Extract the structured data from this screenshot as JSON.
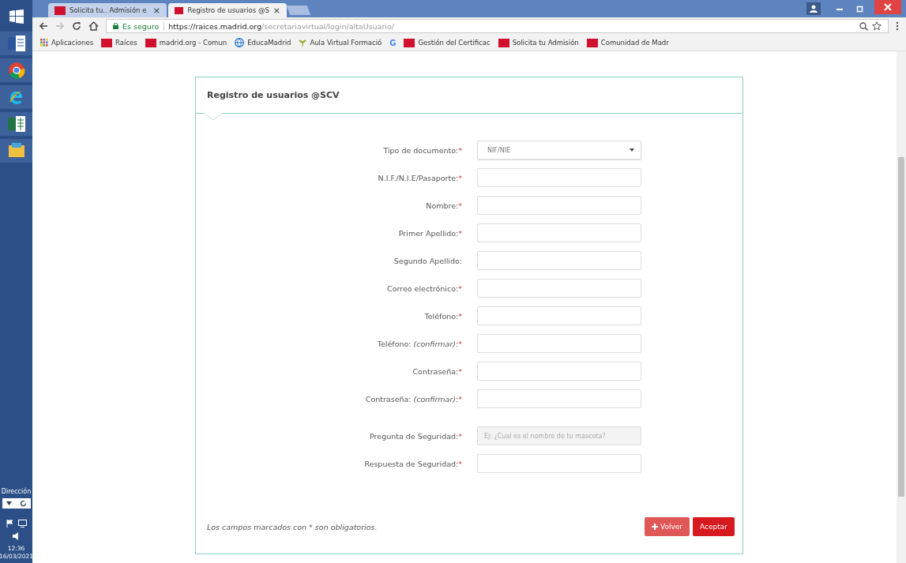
{
  "taskbar": {
    "apps": [
      {
        "kind": "start"
      },
      {
        "kind": "word"
      },
      {
        "kind": "chrome"
      },
      {
        "kind": "ie"
      },
      {
        "kind": "excel"
      },
      {
        "kind": "files"
      }
    ],
    "address_label": "Dirección",
    "time": "12:36",
    "date": "16/03/2021"
  },
  "tabs": [
    {
      "label": "Solicita tu.. Admisión e",
      "close": "×",
      "selected": false
    },
    {
      "label": "Registro de usuarios @S",
      "close": "×",
      "selected": true
    }
  ],
  "toolbar": {
    "secure_label": "Es seguro",
    "url_host": "https://raices.madrid.org",
    "url_path": "/secretariavirtual/login/altaUsuario/"
  },
  "bookmarks": [
    {
      "kind": "apps",
      "label": "Aplicaciones"
    },
    {
      "kind": "site",
      "label": "Raíces"
    },
    {
      "kind": "site",
      "label": "madrid.org - Comun"
    },
    {
      "kind": "globe",
      "label": "EducaMadrid"
    },
    {
      "kind": "plant",
      "label": "Aula Virtual Formació"
    },
    {
      "kind": "google",
      "label": "G"
    },
    {
      "kind": "site",
      "label": "Gestión del Certificac"
    },
    {
      "kind": "site",
      "label": "Solicita tu Admisión"
    },
    {
      "kind": "site",
      "label": "Comunidad de Madr"
    }
  ],
  "card": {
    "title": "Registro de usuarios @SCV",
    "sections": [
      {
        "fields": [
          {
            "kind": "select",
            "label": "Tipo de documento:",
            "required": true,
            "value": "NIF/NIE"
          },
          {
            "kind": "input",
            "label": "N.I.F./N.I.E/Pasaporte:",
            "required": true
          },
          {
            "kind": "input",
            "label": "Nombre:",
            "required": true
          },
          {
            "kind": "input",
            "label": "Primer Apellido:",
            "required": true
          },
          {
            "kind": "input",
            "label": "Segundo Apellido:",
            "required": false
          },
          {
            "kind": "input",
            "label": "Correo electrónico:",
            "required": true
          },
          {
            "kind": "input",
            "label": "Teléfono:",
            "required": true
          },
          {
            "kind": "input",
            "label": "Teléfono: *(confirmar)*:",
            "required": true
          },
          {
            "kind": "input",
            "label": "Contraseña:",
            "required": true
          },
          {
            "kind": "input",
            "label": "Contraseña: *(confirmar)*:",
            "required": true
          }
        ]
      },
      {
        "fields": [
          {
            "kind": "input",
            "label": "Pregunta de Seguridad:",
            "required": true,
            "placeholder": "Ej: ¿Cual es el nombre de tu mascota?"
          },
          {
            "kind": "input",
            "label": "Respuesta de Seguridad:",
            "required": true
          }
        ]
      }
    ],
    "required_mark": "*",
    "note": "Los campos marcados con * son obligatorios.",
    "buttons": [
      {
        "kind": "back",
        "label": "Volver"
      },
      {
        "kind": "primary",
        "label": "Aceptar"
      }
    ]
  }
}
